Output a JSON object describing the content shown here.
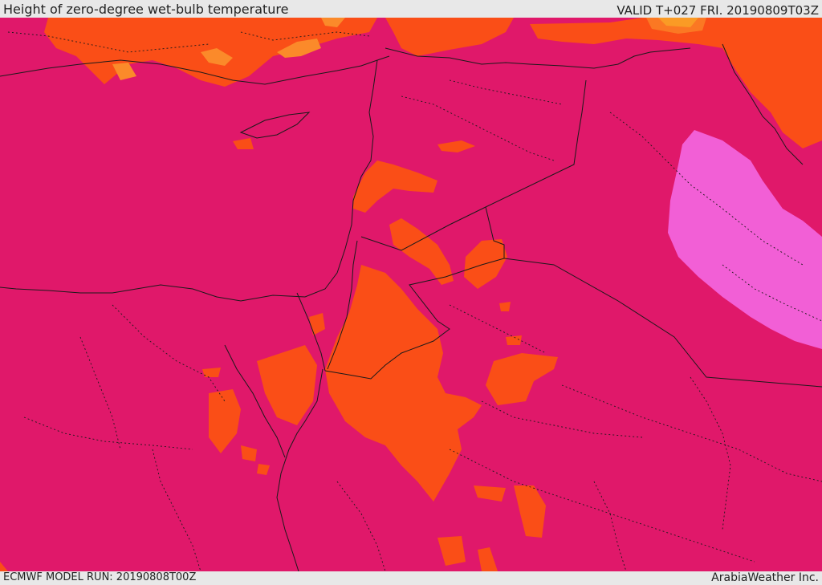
{
  "header": {
    "title": "Height of zero-degree wet-bulb temperature",
    "valid": "VALID T+027 FRI. 20190809T03Z"
  },
  "footer": {
    "model_run": "ECMWF MODEL RUN: 20190808T00Z",
    "credit": "ArabiaWeather Inc."
  },
  "colors": {
    "base": "#e0186a",
    "level_orange": "#fa4e17",
    "level_light_orange": "#fb8a2a",
    "level_yellow": "#f8c21c",
    "level_pink": "#f25fd6",
    "boundary": "#1a1a1a"
  }
}
